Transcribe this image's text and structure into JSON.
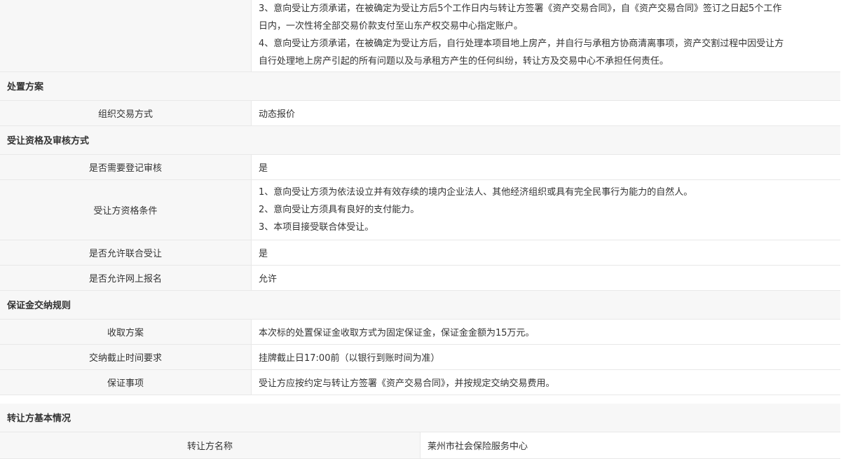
{
  "top_block": {
    "lines": [
      "3、意向受让方须承诺，在被确定为受让方后5个工作日内与转让方签署《资产交易合同》，自《资产交易合同》签订之日起5个工作",
      "日内，一次性将全部交易价款支付至山东产权交易中心指定账户。",
      "4、意向受让方须承诺，在被确定为受让方后，自行处理本项目地上房产，并自行与承租方协商清离事项，资产交割过程中因受让方",
      "自行处理地上房产引起的所有问题以及与承租方产生的任何纠纷，转让方及交易中心不承担任何责任。"
    ]
  },
  "disposal": {
    "section_title": "处置方案",
    "rows": [
      {
        "label": "组织交易方式",
        "value": "动态报价"
      }
    ]
  },
  "qualification": {
    "section_title": "受让资格及审核方式",
    "registration_label": "是否需要登记审核",
    "registration_value": "是",
    "conditions_label": "受让方资格条件",
    "conditions": [
      "1、意向受让方须为依法设立并有效存续的境内企业法人、其他经济组织或具有完全民事行为能力的自然人。",
      "2、意向受让方须具有良好的支付能力。",
      "3、本项目接受联合体受让。"
    ],
    "joint_label": "是否允许联合受让",
    "joint_value": "是",
    "online_label": "是否允许网上报名",
    "online_value": "允许"
  },
  "deposit": {
    "section_title": "保证金交纳规则",
    "rows": [
      {
        "label": "收取方案",
        "value": "本次标的处置保证金收取方式为固定保证金，保证金金额为15万元。"
      },
      {
        "label": "交纳截止时间要求",
        "value": "挂牌截止日17:00前（以银行到账时间为准）"
      },
      {
        "label": "保证事项",
        "value": "受让方应按约定与转让方签署《资产交易合同》，并按规定交纳交易费用。"
      }
    ]
  },
  "transferor": {
    "section_title": "转让方基本情况",
    "name_label": "转让方名称",
    "name_value": "莱州市社会保险服务中心"
  }
}
